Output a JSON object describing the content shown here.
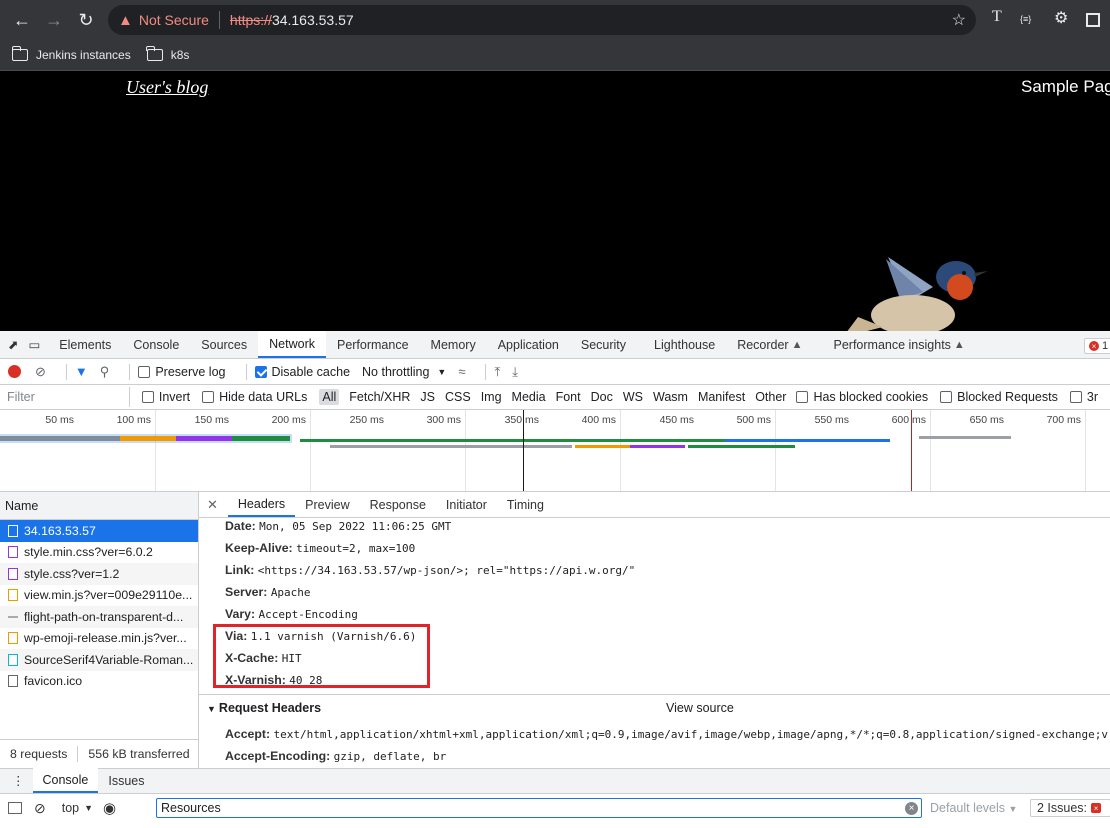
{
  "browser": {
    "security_label": "Not Secure",
    "url_scheme": "https://",
    "url_host": "34.163.53.57",
    "extension_label": "T",
    "extension2_label": "{≡}",
    "bookmarks": [
      "Jenkins instances",
      "k8s"
    ]
  },
  "page": {
    "blog_title": "User's blog",
    "nav_link": "Sample Page"
  },
  "devtools": {
    "tabs": [
      "Elements",
      "Console",
      "Sources",
      "Network",
      "Performance",
      "Memory",
      "Application",
      "Security",
      "Lighthouse",
      "Recorder",
      "Performance insights"
    ],
    "active_tab": "Network",
    "error_count": "1",
    "network_toolbar": {
      "preserve_log": "Preserve log",
      "disable_cache": "Disable cache",
      "throttling": "No throttling"
    },
    "filter": {
      "placeholder": "Filter",
      "invert": "Invert",
      "hide_data_urls": "Hide data URLs",
      "types": [
        "All",
        "Fetch/XHR",
        "JS",
        "CSS",
        "Img",
        "Media",
        "Font",
        "Doc",
        "WS",
        "Wasm",
        "Manifest",
        "Other"
      ],
      "has_blocked_cookies": "Has blocked cookies",
      "blocked_requests": "Blocked Requests",
      "third_party": "3r"
    },
    "timeline_ticks": [
      "50 ms",
      "100 ms",
      "150 ms",
      "200 ms",
      "250 ms",
      "300 ms",
      "350 ms",
      "400 ms",
      "450 ms",
      "500 ms",
      "550 ms",
      "600 ms",
      "650 ms",
      "700 ms"
    ],
    "requests": {
      "header": "Name",
      "items": [
        {
          "name": "34.163.53.57",
          "type": "doc"
        },
        {
          "name": "style.min.css?ver=6.0.2",
          "type": "css"
        },
        {
          "name": "style.css?ver=1.2",
          "type": "css"
        },
        {
          "name": "view.min.js?ver=009e29110e...",
          "type": "js"
        },
        {
          "name": "flight-path-on-transparent-d...",
          "type": "img"
        },
        {
          "name": "wp-emoji-release.min.js?ver...",
          "type": "js"
        },
        {
          "name": "SourceSerif4Variable-Roman...",
          "type": "font"
        },
        {
          "name": "favicon.ico",
          "type": "other"
        }
      ],
      "summary_count": "8 requests",
      "summary_transferred": "556 kB transferred"
    },
    "detail_tabs": [
      "Headers",
      "Preview",
      "Response",
      "Initiator",
      "Timing"
    ],
    "response_headers": [
      {
        "key": "Date:",
        "value": "Mon, 05 Sep 2022 11:06:25 GMT"
      },
      {
        "key": "Keep-Alive:",
        "value": "timeout=2, max=100"
      },
      {
        "key": "Link:",
        "value": "<https://34.163.53.57/wp-json/>; rel=\"https://api.w.org/\""
      },
      {
        "key": "Server:",
        "value": "Apache"
      },
      {
        "key": "Vary:",
        "value": "Accept-Encoding"
      },
      {
        "key": "Via:",
        "value": "1.1 varnish (Varnish/6.6)"
      },
      {
        "key": "X-Cache:",
        "value": "HIT"
      },
      {
        "key": "X-Varnish:",
        "value": "40 28"
      }
    ],
    "request_headers_title": "Request Headers",
    "view_source": "View source",
    "request_headers": [
      {
        "key": "Accept:",
        "value": "text/html,application/xhtml+xml,application/xml;q=0.9,image/avif,image/webp,image/apng,*/*;q=0.8,application/signed-exchange;v"
      },
      {
        "key": "Accept-Encoding:",
        "value": "gzip, deflate, br"
      }
    ]
  },
  "drawer": {
    "tabs": [
      "Console",
      "Issues"
    ],
    "context": "top",
    "input_value": "Resources",
    "levels": "Default levels",
    "issues": "2 Issues:"
  }
}
